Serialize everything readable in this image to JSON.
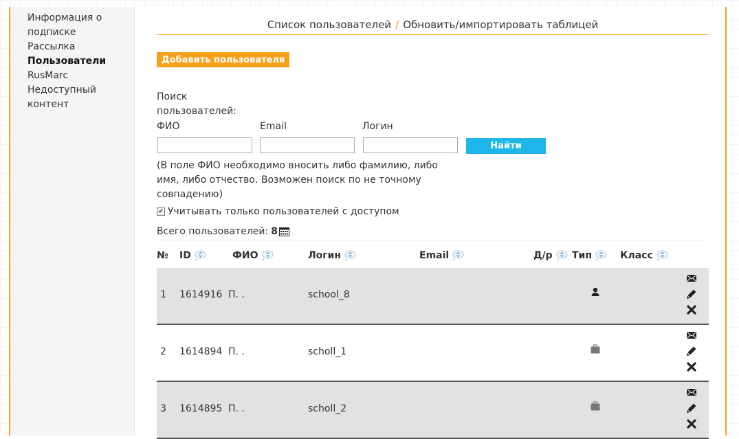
{
  "sidebar": {
    "items": [
      {
        "label": "Информация о подписке",
        "active": false
      },
      {
        "label": "Рассылка",
        "active": false
      },
      {
        "label": "Пользователи",
        "active": true
      },
      {
        "label": "RusMarc",
        "active": false
      },
      {
        "label": "Недоступный контент",
        "active": false
      }
    ]
  },
  "breadcrumb": {
    "item1": "Список пользователей",
    "separator": "/",
    "item2": "Обновить/импортировать таблицей"
  },
  "add_user_label": "Добавить пользователя",
  "search": {
    "title": "Поиск пользователей:",
    "fio_label": "ФИО",
    "email_label": "Email",
    "login_label": "Логин",
    "fio_value": "",
    "email_value": "",
    "login_value": "",
    "find_label": "Найти",
    "hint": "(В поле ФИО необходимо вносить либо фамилию, либо имя, либо отчество. Возможен поиск по не точному совпадению)",
    "only_access_label": "Учитывать только пользователей с доступом",
    "only_access_checked": true
  },
  "total": {
    "label": "Всего пользователей:",
    "value": "8"
  },
  "table": {
    "columns": {
      "num": "№",
      "id": "ID",
      "fio": "ФИО",
      "login": "Логин",
      "email": "Email",
      "dob": "Д/р",
      "type": "Тип",
      "class": "Класс"
    },
    "rows": [
      {
        "num": "1",
        "id": "1614916",
        "fio": "П. .",
        "login": "school_8",
        "email": "",
        "type_icon": "person-icon"
      },
      {
        "num": "2",
        "id": "1614894",
        "fio": "П. .",
        "login": "scholl_1",
        "email": "",
        "type_icon": "briefcase-icon"
      },
      {
        "num": "3",
        "id": "1614895",
        "fio": "П. .",
        "login": "scholl_2",
        "email": "",
        "type_icon": "briefcase-icon"
      }
    ]
  },
  "colors": {
    "accent": "#f7a01c",
    "find_button": "#1fb6ea",
    "row_shade": "#e2e2e2"
  }
}
